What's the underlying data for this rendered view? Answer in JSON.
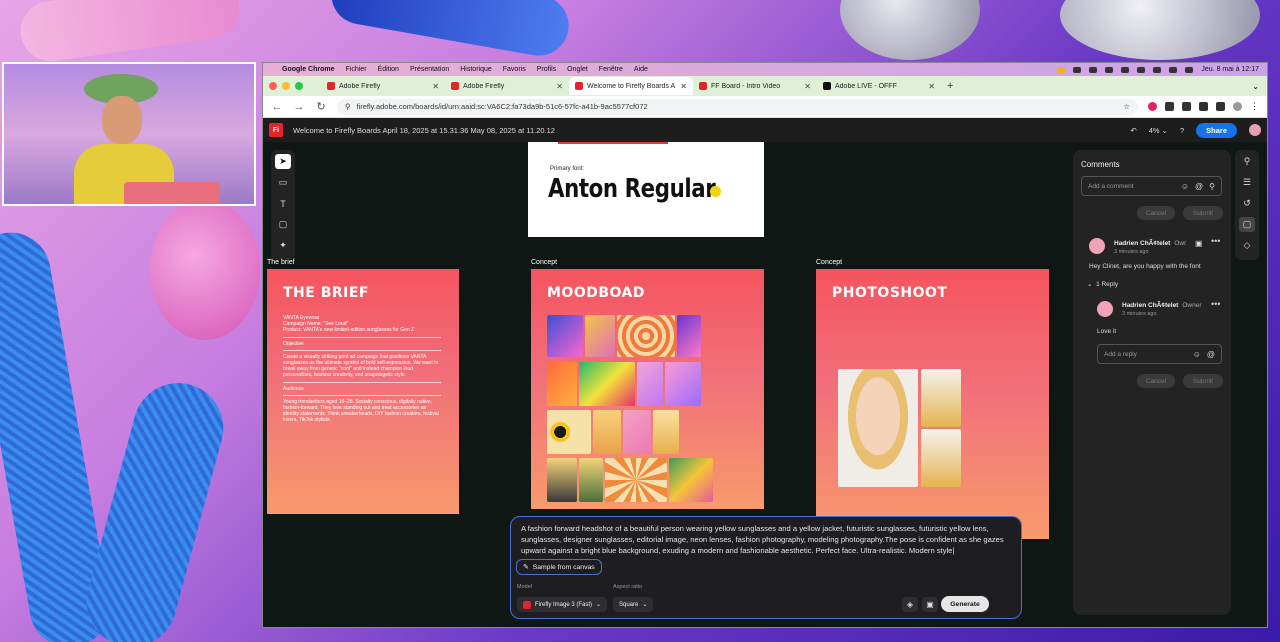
{
  "mac_menu": {
    "apple": "",
    "app_name": "Google Chrome",
    "items": [
      "Fichier",
      "Édition",
      "Présentation",
      "Historique",
      "Favoris",
      "Profils",
      "Onglet",
      "Fenêtre",
      "Aide"
    ],
    "clock": "Jeu. 8 mai à 12:17"
  },
  "tabs": [
    {
      "label": "Adobe Firefly",
      "active": false
    },
    {
      "label": "Adobe Firefly",
      "active": false
    },
    {
      "label": "Welcome to Firefly Boards A",
      "active": true
    },
    {
      "label": "FF Board - Intro Video",
      "active": false
    },
    {
      "label": "Adobe LIVE - OFFF",
      "active": false
    }
  ],
  "address": {
    "url": "firefly.adobe.com/boards/id/urn:aaid:sc:VA6C2:fa73da9b-51c6-57fc-a41b-9ac5577cf072"
  },
  "header": {
    "logo": "Fi",
    "title": "Welcome to Firefly Boards April 18, 2025 at 15.31.36 May 08, 2025 at 11.20.12",
    "zoom": "4%",
    "share_label": "Share"
  },
  "font_card": {
    "label": "Primary font:",
    "font_name": "Anton Regular"
  },
  "boards": {
    "brief": {
      "caption": "The brief",
      "title": "THE BRIEF",
      "line1": "VANTA Eyewear",
      "line2": "Campaign Name: \"See Loud\"",
      "line3": "Product: VANTA's new limited-edition sunglasses for Gen Z",
      "objective_heading": "Objective",
      "objective": "Create a visually striking print ad campaign that positions VANTA sunglasses as the ultimate symbol of bold self-expression. We want to break away from generic \"cool\" and instead champion loud personalities, fearless creativity, and unapologetic style.",
      "audience_heading": "Audience",
      "audience": "Young trendsetters aged 16–28. Socially conscious, digitally native, fashion-forward. They love standing out and treat accessories as identity statements. Think sneakerheads, DIY fashion creators, festival lovers, TikTok stylists."
    },
    "moodboard": {
      "caption": "Concept",
      "title": "MOODBOAD"
    },
    "photoshoot": {
      "caption": "Concept",
      "title": "PHOTOSHOOT"
    }
  },
  "comments": {
    "title": "Comments",
    "input_placeholder": "Add a comment",
    "cancel": "Cancel",
    "submit": "Submit",
    "thread": {
      "author": "Hadrien ChÃ¢telet",
      "role": "Owr",
      "time": "3 minutes ago",
      "body": "Hey Clinet, are you happy with the font",
      "replies_label": "1 Reply",
      "reply": {
        "author": "Hadrien ChÃ¢telet",
        "role": "Owner",
        "time": "3 minutes ago",
        "body": "Love it"
      },
      "reply_placeholder": "Add a reply"
    }
  },
  "prompt": {
    "text": "A fashion forward headshot of a beautiful person wearing yellow sunglasses and a yellow jacket, futuristic sunglasses, futuristic yellow lens, sunglasses, designer sunglasses, editorial image, neon lenses, fashion photography, modeling photography.The pose is confident as she gazes upward against a bright blue background, exuding a modern and fashionable aesthetic. Perfect face. Ultra-realistic. Modern style|",
    "sample_label": "Sample from canvas",
    "model_label": "Model",
    "model_value": "Firefly Image 3 (Fast)",
    "aspect_label": "Aspect ratio",
    "aspect_value": "Square",
    "generate_label": "Generate"
  },
  "colors": {
    "accent": "#1473e6",
    "board_top": "#f4545f",
    "board_bottom": "#f89a6c",
    "prompt_border": "#4a6fd6"
  }
}
